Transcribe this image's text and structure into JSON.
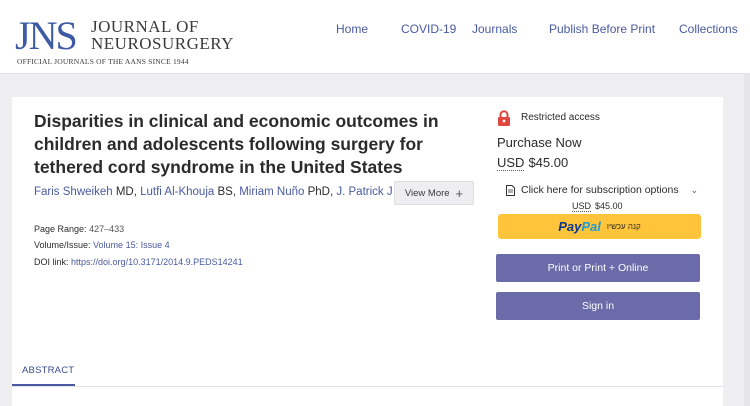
{
  "header": {
    "logo": {
      "abbr": "JNS",
      "line1": "JOURNAL OF",
      "line2": "NEUROSURGERY",
      "tagline": "OFFICIAL JOURNALS OF THE AANS SINCE 1944"
    },
    "nav": [
      "Home",
      "COVID-19",
      "Journals",
      "Publish Before Print",
      "Collections"
    ]
  },
  "article": {
    "title": "Disparities in clinical and economic outcomes in children and adolescents following surgery for tethered cord syndrome in the United States",
    "authors": [
      {
        "name": "Faris Shweikeh",
        "degree": "MD"
      },
      {
        "name": "Lutfi Al-Khouja",
        "degree": "BS"
      },
      {
        "name": "Miriam Nuño",
        "degree": "PhD"
      },
      {
        "name": "J. Patrick J…",
        "degree": ""
      }
    ],
    "view_more_label": "View More",
    "page_range_label": "Page Range:",
    "page_range": "427–433",
    "volume_label": "Volume/Issue:",
    "volume": "Volume 15: Issue 4",
    "doi_label": "DOI link:",
    "doi": "https://doi.org/10.3171/2014.9.PEDS14241"
  },
  "purchase": {
    "access_text": "Restricted access",
    "purchase_now": "Purchase Now",
    "currency": "USD",
    "price": "$45.00",
    "subscription_options": "Click here for subscription options",
    "subscription_currency": "USD",
    "subscription_price": "$45.00",
    "paypal_pay": "Pay",
    "paypal_pal": "Pal",
    "paypal_text": "קנה עכשיו",
    "print_button": "Print or Print + Online",
    "signin_button": "Sign in"
  },
  "tabs": {
    "abstract": "ABSTRACT"
  },
  "colors": {
    "brand_blue": "#3c5ba4",
    "link": "#4a5aa0",
    "button": "#6b6baa",
    "paypal": "#ffc439",
    "lock": "#e0463c"
  }
}
